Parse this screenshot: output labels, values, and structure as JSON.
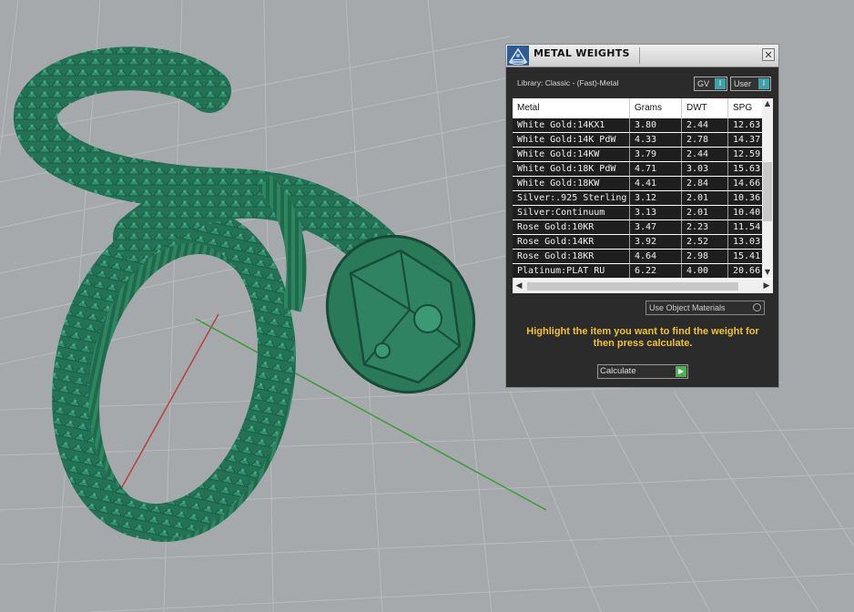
{
  "panel": {
    "title": "METAL WEIGHTS",
    "close_icon": "close-icon",
    "library_label": "Library: Classic - (Fast)-Metal",
    "toggle_gv": "GV",
    "toggle_user": "User",
    "table": {
      "columns": [
        "Metal",
        "Grams",
        "DWT",
        "SPG"
      ],
      "rows": [
        [
          "White Gold:14KX1",
          "3.80",
          "2.44",
          "12.63"
        ],
        [
          "White Gold:14K PdW",
          "4.33",
          "2.78",
          "14.37"
        ],
        [
          "White Gold:14KW",
          "3.79",
          "2.44",
          "12.59"
        ],
        [
          "White Gold:18K PdW",
          "4.71",
          "3.03",
          "15.63"
        ],
        [
          "White Gold:18KW",
          "4.41",
          "2.84",
          "14.66"
        ],
        [
          "Silver:.925 Sterling",
          "3.12",
          "2.01",
          "10.36"
        ],
        [
          "Silver:Continuum",
          "3.13",
          "2.01",
          "10.40"
        ],
        [
          "Rose Gold:10KR",
          "3.47",
          "2.23",
          "11.54"
        ],
        [
          "Rose Gold:14KR",
          "3.92",
          "2.52",
          "13.03"
        ],
        [
          "Rose Gold:18KR",
          "4.64",
          "2.98",
          "15.41"
        ],
        [
          "Platinum:PLAT RU",
          "6.22",
          "4.00",
          "20.66"
        ]
      ]
    },
    "use_object_materials": "Use Object Materials",
    "instructions": "Highlight the item you want to find the weight for then press calculate.",
    "calculate_label": "Calculate"
  },
  "colors": {
    "viewport_bg": "#a6a9ab",
    "model": "#2a7a5a",
    "instructions": "#f2c230",
    "axis_x": "#b84040",
    "axis_y": "#3a9a3a"
  }
}
